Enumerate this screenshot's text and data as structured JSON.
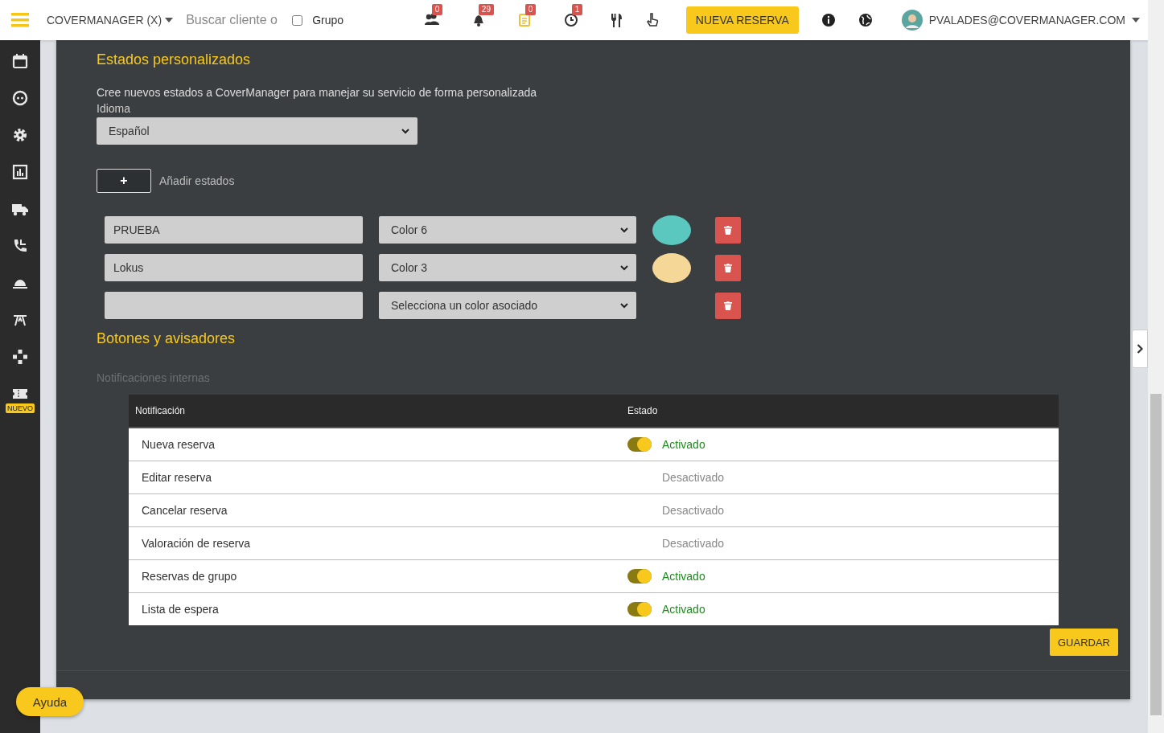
{
  "topbar": {
    "account": "COVERMANAGER (X)",
    "search": {
      "placeholder": "Buscar cliente o"
    },
    "group_filter": {
      "label": "Grupo",
      "checked": false
    },
    "indicators": [
      {
        "badge": "0"
      },
      {
        "badge": "29"
      },
      {
        "badge": "0"
      },
      {
        "badge": "1"
      }
    ],
    "new_reservation_button": "NUEVA RESERVA",
    "user": "PVALADES@COVERMANAGER.COM"
  },
  "sidebar": {
    "new_badge": "NUEVO"
  },
  "custom_states": {
    "title": "Estados personalizados",
    "description": "Cree nuevos estados a CoverManager para manejar su servicio de forma personalizada",
    "language_label": "Idioma",
    "language": "Español",
    "add_button": "+",
    "add_label": "Añadir estados",
    "rows": [
      {
        "name": "PRUEBA",
        "color_option": "Color 6",
        "color": "#5ac8be"
      },
      {
        "name": "Lokus",
        "color_option": "Color 3",
        "color": "#f5d898"
      },
      {
        "color_placeholder": "Selecciona un color asociado"
      }
    ]
  },
  "notifications": {
    "title": "Botones y avisadores",
    "subtitle": "Notificaciones internas",
    "columns": [
      "Notificación",
      "Estado"
    ],
    "rows": [
      {
        "name": "Nueva reserva",
        "on": true,
        "status": "Activado"
      },
      {
        "name": "Editar reserva",
        "on": false,
        "status": "Desactivado"
      },
      {
        "name": "Cancelar reserva",
        "on": false,
        "status": "Desactivado"
      },
      {
        "name": "Valoración de reserva",
        "on": false,
        "status": "Desactivado"
      },
      {
        "name": "Reservas de grupo",
        "on": true,
        "status": "Activado"
      },
      {
        "name": "Lista de espera",
        "on": true,
        "status": "Activado"
      }
    ],
    "save_button": "GUARDAR"
  },
  "help_button": "Ayuda"
}
